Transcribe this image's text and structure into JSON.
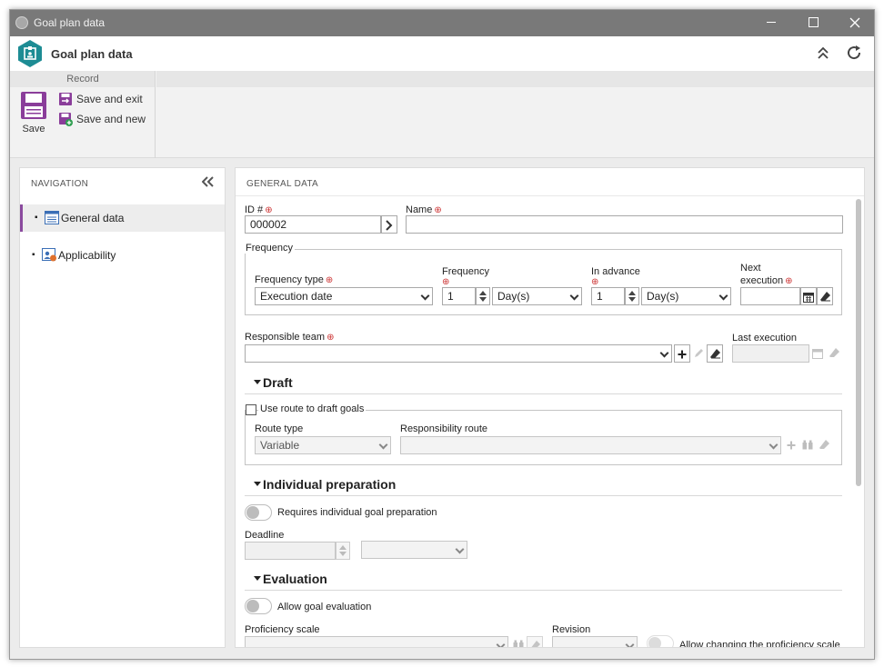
{
  "window": {
    "title": "Goal plan data"
  },
  "header": {
    "title": "Goal plan data"
  },
  "ribbon": {
    "group_label": "Record",
    "save_label": "Save",
    "save_exit_label": "Save and exit",
    "save_new_label": "Save and new"
  },
  "navigation": {
    "title": "NAVIGATION",
    "items": [
      {
        "label": "General data",
        "active": true
      },
      {
        "label": "Applicability",
        "active": false
      }
    ]
  },
  "general": {
    "title": "GENERAL DATA",
    "id_label": "ID #",
    "id_value": "000002",
    "name_label": "Name",
    "name_value": "",
    "frequency_group": "Frequency",
    "frequency_type_label": "Frequency type",
    "frequency_type_value": "Execution date",
    "frequency_label": "Frequency",
    "frequency_value": "1",
    "frequency_unit": "Day(s)",
    "in_advance_label": "In advance",
    "in_advance_value": "1",
    "in_advance_unit": "Day(s)",
    "next_execution_label_1": "Next",
    "next_execution_label_2": "execution",
    "responsible_team_label": "Responsible team",
    "last_execution_label": "Last execution"
  },
  "draft": {
    "title": "Draft",
    "use_route_label": "Use route to draft goals",
    "route_type_label": "Route type",
    "route_type_value": "Variable",
    "responsibility_route_label": "Responsibility route"
  },
  "individual": {
    "title": "Individual preparation",
    "toggle_label": "Requires individual goal preparation",
    "deadline_label": "Deadline"
  },
  "evaluation": {
    "title": "Evaluation",
    "toggle_label": "Allow goal evaluation",
    "proficiency_label": "Proficiency scale",
    "revision_label": "Revision",
    "allow_change_label": "Allow changing the proficiency scale"
  }
}
